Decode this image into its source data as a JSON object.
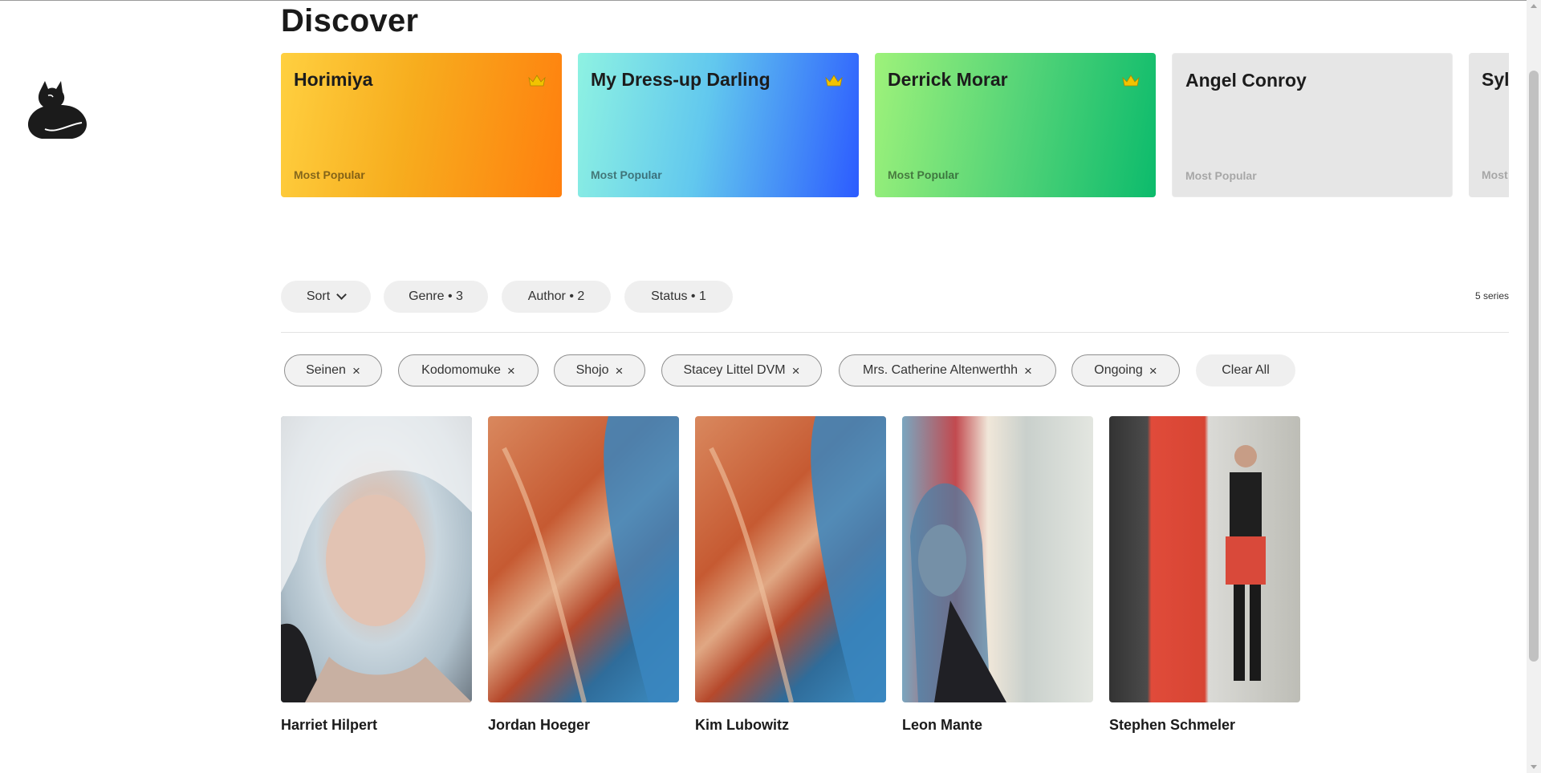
{
  "page": {
    "title": "Discover"
  },
  "featured": [
    {
      "title": "Horimiya",
      "subtitle": "Most Popular",
      "crown": true
    },
    {
      "title": "My Dress-up Darling",
      "subtitle": "Most Popular",
      "crown": true
    },
    {
      "title": "Derrick Morar",
      "subtitle": "Most Popular",
      "crown": true
    },
    {
      "title": "Angel Conroy",
      "subtitle": "Most Popular",
      "crown": false
    },
    {
      "title": "Syl",
      "subtitle": "Most",
      "crown": false
    }
  ],
  "toolbar": {
    "sort_label": "Sort",
    "genre_label": "Genre • 3",
    "author_label": "Author • 2",
    "status_label": "Status • 1",
    "count_text": "5 series"
  },
  "chips": [
    {
      "label": "Seinen"
    },
    {
      "label": "Kodomomuke"
    },
    {
      "label": "Shojo"
    },
    {
      "label": "Stacey Littel DVM"
    },
    {
      "label": "Mrs. Catherine Altenwerthh"
    },
    {
      "label": "Ongoing"
    }
  ],
  "clear_all_label": "Clear All",
  "series": [
    {
      "name": "Harriet Hilpert"
    },
    {
      "name": "Jordan Hoeger"
    },
    {
      "name": "Kim Lubowitz"
    },
    {
      "name": "Leon Mante"
    },
    {
      "name": "Stephen Schmeler"
    }
  ],
  "colors": {
    "crown": "#f2c300",
    "chip_border": "#8e8e8e",
    "pill_bg": "#efefef"
  },
  "icons": [
    "cat-logo-icon",
    "crown-icon",
    "chevron-down-icon",
    "close-icon"
  ]
}
